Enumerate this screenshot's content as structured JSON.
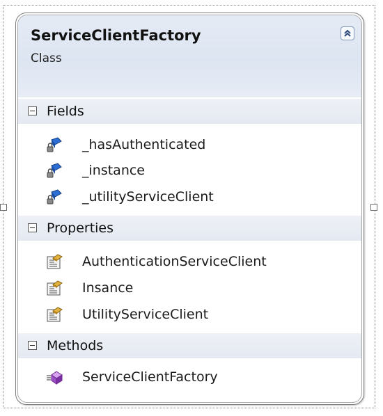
{
  "class": {
    "name": "ServiceClientFactory",
    "kind": "Class"
  },
  "sections": {
    "fields": {
      "title": "Fields",
      "items": [
        "_hasAuthenticated",
        "_instance",
        "_utilityServiceClient"
      ]
    },
    "properties": {
      "title": "Properties",
      "items": [
        "AuthenticationServiceClient",
        "Insance",
        "UtilityServiceClient"
      ]
    },
    "methods": {
      "title": "Methods",
      "items": [
        "ServiceClientFactory"
      ]
    }
  },
  "icons": {
    "collapse": "double-chevron-up-icon",
    "field": "private-field-icon",
    "property": "property-icon",
    "method": "method-icon",
    "section_toggle": "minus-box-icon"
  },
  "colors": {
    "header_bg": "#dde5f2",
    "section_bg": "#e8ecf3",
    "border": "#7f7f7f"
  }
}
